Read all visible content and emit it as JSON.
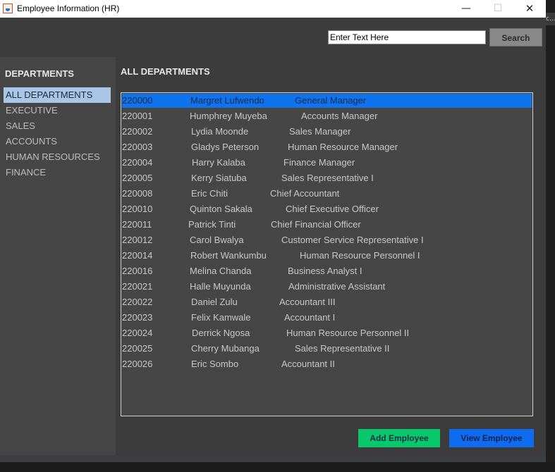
{
  "window": {
    "title": "Employee Information (HR)",
    "minimize_glyph": "—",
    "maximize_glyph": "☐",
    "close_glyph": "✕",
    "icon": "java-icon"
  },
  "desktop": {
    "edge_text": "c..."
  },
  "search": {
    "value": "Enter Text Here",
    "button_label": "Search"
  },
  "sidebar": {
    "title": "DEPARTMENTS",
    "items": [
      "ALL DEPARTMENTS",
      "EXECUTIVE",
      "SALES",
      "ACCOUNTS",
      "HUMAN RESOURCES",
      "FINANCE"
    ],
    "selected": "ALL DEPARTMENTS"
  },
  "main": {
    "title": "ALL DEPARTMENTS",
    "employees": [
      {
        "id": "220000",
        "name": "Margret Lufwendo",
        "position": "General Manager"
      },
      {
        "id": "220001",
        "name": "Humphrey Muyeba",
        "position": "Accounts Manager"
      },
      {
        "id": "220002",
        "name": "Lydia Moonde",
        "position": "Sales Manager"
      },
      {
        "id": "220003",
        "name": "Gladys Peterson",
        "position": "Human Resource Manager"
      },
      {
        "id": "220004",
        "name": "Harry Kalaba",
        "position": "Finance Manager"
      },
      {
        "id": "220005",
        "name": "Kerry Siatuba",
        "position": "Sales Representative I"
      },
      {
        "id": "220008",
        "name": "Eric Chiti",
        "position": "Chief Accountant"
      },
      {
        "id": "220010",
        "name": "Quinton Sakala",
        "position": "Chief Executive Officer"
      },
      {
        "id": "220011",
        "name": "Patrick Tinti",
        "position": "Chief Financial Officer"
      },
      {
        "id": "220012",
        "name": "Carol Bwalya",
        "position": "Customer Service Representative I"
      },
      {
        "id": "220014",
        "name": "Robert Wankumbu",
        "position": "Human Resource Personnel I"
      },
      {
        "id": "220016",
        "name": "Melina Chanda",
        "position": "Business Analyst I"
      },
      {
        "id": "220021",
        "name": "Halle Muyunda",
        "position": "Administrative Assistant"
      },
      {
        "id": "220022",
        "name": "Daniel Zulu",
        "position": "Accountant III"
      },
      {
        "id": "220023",
        "name": "Felix Kamwale",
        "position": "Accountant I"
      },
      {
        "id": "220024",
        "name": "Derrick Ngosa",
        "position": "Human Resource Personnel II"
      },
      {
        "id": "220025",
        "name": "Cherry Mubanga",
        "position": "Sales Representative II"
      },
      {
        "id": "220026",
        "name": "Eric Sombo",
        "position": "Accountant II"
      }
    ],
    "selected_id": "220000"
  },
  "actions": {
    "add_label": "Add Employee",
    "view_label": "View Employee"
  },
  "colors": {
    "selection_blue": "#0f73ee",
    "add_green": "#09c86b",
    "view_blue": "#0f6cf0"
  }
}
